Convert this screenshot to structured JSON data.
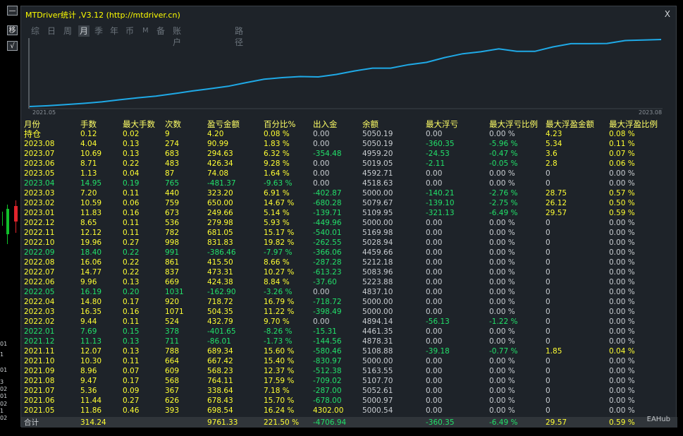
{
  "title": "MTDriver统计 ,V3.12 (http://mtdriver.cn)",
  "close_label": "X",
  "left_buttons": [
    "—",
    "移",
    "√"
  ],
  "side_axis_labels": [
    "01",
    "1",
    "01",
    "3",
    "02",
    "01",
    "02",
    "1",
    "02"
  ],
  "tabs": [
    "综",
    "日",
    "周",
    "月",
    "季",
    "年",
    "币",
    "M",
    "备",
    "账户",
    "路径"
  ],
  "active_tab": "月",
  "chart": {
    "x_start": "2021.05",
    "x_end": "2023.08",
    "line_color": "#1fa9e6",
    "values": [
      4902,
      4910,
      4922,
      4935,
      4950,
      4972,
      4993,
      5010,
      5035,
      5063,
      5086,
      5112,
      5150,
      5185,
      5202,
      5213,
      5209,
      5235,
      5271,
      5300,
      5300,
      5336,
      5360,
      5410,
      5449,
      5470,
      5500,
      5474,
      5474,
      5520,
      5554,
      5554,
      5556,
      5586,
      5592,
      5597
    ]
  },
  "columns": [
    "月份",
    "手数",
    "最大手数",
    "次数",
    "盈亏金额",
    "百分比%",
    "出入金",
    "余额",
    "最大浮亏",
    "最大浮亏比例",
    "最大浮盈金额",
    "最大浮盈比例"
  ],
  "rows": [
    {
      "c": [
        "持仓",
        "0.12",
        "0.02",
        "9",
        "4.20",
        "0.08 %",
        "0.00",
        "5050.19",
        "0.00",
        "0.00 %",
        "4.23",
        "0.08 %"
      ],
      "cls": "y",
      "f": {
        "8": "w",
        "9": "w",
        "6": "w",
        "7": "w"
      }
    },
    {
      "c": [
        "2023.08",
        "4.04",
        "0.13",
        "274",
        "90.99",
        "1.83 %",
        "0.00",
        "5050.19",
        "-360.35",
        "-5.96 %",
        "5.34",
        "0.11 %"
      ],
      "cls": "y",
      "f": {
        "6": "w",
        "7": "w",
        "8": "g",
        "9": "g"
      }
    },
    {
      "c": [
        "2023.07",
        "10.69",
        "0.13",
        "683",
        "294.63",
        "6.32 %",
        "-354.48",
        "4959.20",
        "-24.53",
        "-0.47 %",
        "3.6",
        "0.07 %"
      ],
      "cls": "y",
      "f": {
        "6": "g",
        "7": "w",
        "8": "g",
        "9": "g"
      }
    },
    {
      "c": [
        "2023.06",
        "8.71",
        "0.22",
        "483",
        "426.34",
        "9.28 %",
        "0.00",
        "5019.05",
        "-2.11",
        "-0.05 %",
        "2.8",
        "0.06 %"
      ],
      "cls": "y",
      "f": {
        "6": "w",
        "7": "w",
        "8": "g",
        "9": "g"
      }
    },
    {
      "c": [
        "2023.05",
        "1.13",
        "0.04",
        "87",
        "74.08",
        "1.64 %",
        "0.00",
        "4592.71",
        "0.00",
        "0.00 %",
        "0",
        "0.00 %"
      ],
      "cls": "y",
      "f": {
        "6": "w",
        "7": "w",
        "8": "w",
        "9": "w",
        "10": "w",
        "11": "w"
      }
    },
    {
      "c": [
        "2023.04",
        "14.95",
        "0.19",
        "765",
        "-481.37",
        "-9.63 %",
        "0.00",
        "4518.63",
        "0.00",
        "0.00 %",
        "0",
        "0.00 %"
      ],
      "cls": "g",
      "f": {
        "6": "w",
        "7": "w",
        "8": "w",
        "9": "w",
        "10": "w",
        "11": "w"
      }
    },
    {
      "c": [
        "2023.03",
        "7.20",
        "0.11",
        "440",
        "323.20",
        "6.91 %",
        "-402.87",
        "5000.00",
        "-140.21",
        "-2.76 %",
        "28.75",
        "0.57 %"
      ],
      "cls": "y",
      "f": {
        "6": "g",
        "7": "w",
        "8": "g",
        "9": "g"
      }
    },
    {
      "c": [
        "2023.02",
        "10.59",
        "0.06",
        "759",
        "650.00",
        "14.67 %",
        "-680.28",
        "5079.67",
        "-139.10",
        "-2.75 %",
        "26.12",
        "0.50 %"
      ],
      "cls": "y",
      "f": {
        "6": "g",
        "7": "w",
        "8": "g",
        "9": "g"
      }
    },
    {
      "c": [
        "2023.01",
        "11.83",
        "0.16",
        "673",
        "249.66",
        "5.14 %",
        "-139.71",
        "5109.95",
        "-321.13",
        "-6.49 %",
        "29.57",
        "0.59 %"
      ],
      "cls": "y",
      "f": {
        "6": "g",
        "7": "w",
        "8": "g",
        "9": "g"
      }
    },
    {
      "c": [
        "2022.12",
        "8.65",
        "0.11",
        "536",
        "279.98",
        "5.93 %",
        "-449.96",
        "5000.00",
        "0.00",
        "0.00 %",
        "0",
        "0.00 %"
      ],
      "cls": "y",
      "f": {
        "6": "g",
        "7": "w",
        "8": "w",
        "9": "w",
        "10": "w",
        "11": "w"
      }
    },
    {
      "c": [
        "2022.11",
        "12.12",
        "0.11",
        "782",
        "681.05",
        "15.17 %",
        "-540.01",
        "5169.98",
        "0.00",
        "0.00 %",
        "0",
        "0.00 %"
      ],
      "cls": "y",
      "f": {
        "6": "g",
        "7": "w",
        "8": "w",
        "9": "w",
        "10": "w",
        "11": "w"
      }
    },
    {
      "c": [
        "2022.10",
        "19.96",
        "0.27",
        "998",
        "831.83",
        "19.82 %",
        "-262.55",
        "5028.94",
        "0.00",
        "0.00 %",
        "0",
        "0.00 %"
      ],
      "cls": "y",
      "f": {
        "6": "g",
        "7": "w",
        "8": "w",
        "9": "w",
        "10": "w",
        "11": "w"
      }
    },
    {
      "c": [
        "2022.09",
        "18.40",
        "0.22",
        "991",
        "-386.46",
        "-7.97 %",
        "-366.06",
        "4459.66",
        "0.00",
        "0.00 %",
        "0",
        "0.00 %"
      ],
      "cls": "g",
      "f": {
        "7": "w",
        "8": "w",
        "9": "w",
        "10": "w",
        "11": "w"
      }
    },
    {
      "c": [
        "2022.08",
        "16.06",
        "0.22",
        "861",
        "415.50",
        "8.66 %",
        "-287.28",
        "5212.18",
        "0.00",
        "0.00 %",
        "0",
        "0.00 %"
      ],
      "cls": "y",
      "f": {
        "6": "g",
        "7": "w",
        "8": "w",
        "9": "w",
        "10": "w",
        "11": "w"
      }
    },
    {
      "c": [
        "2022.07",
        "14.77",
        "0.22",
        "837",
        "473.31",
        "10.27 %",
        "-613.23",
        "5083.96",
        "0.00",
        "0.00 %",
        "0",
        "0.00 %"
      ],
      "cls": "y",
      "f": {
        "6": "g",
        "7": "w",
        "8": "w",
        "9": "w",
        "10": "w",
        "11": "w"
      }
    },
    {
      "c": [
        "2022.06",
        "9.96",
        "0.13",
        "669",
        "424.38",
        "8.84 %",
        "-37.60",
        "5223.88",
        "0.00",
        "0.00 %",
        "0",
        "0.00 %"
      ],
      "cls": "y",
      "f": {
        "6": "g",
        "7": "w",
        "8": "w",
        "9": "w",
        "10": "w",
        "11": "w"
      }
    },
    {
      "c": [
        "2022.05",
        "16.19",
        "0.20",
        "1031",
        "-162.90",
        "-3.26 %",
        "0.00",
        "4837.10",
        "0.00",
        "0.00 %",
        "0",
        "0.00 %"
      ],
      "cls": "g",
      "f": {
        "6": "w",
        "7": "w",
        "8": "w",
        "9": "w",
        "10": "w",
        "11": "w"
      }
    },
    {
      "c": [
        "2022.04",
        "14.80",
        "0.17",
        "920",
        "718.72",
        "16.79 %",
        "-718.72",
        "5000.00",
        "0.00",
        "0.00 %",
        "0",
        "0.00 %"
      ],
      "cls": "y",
      "f": {
        "6": "g",
        "7": "w",
        "8": "w",
        "9": "w",
        "10": "w",
        "11": "w"
      }
    },
    {
      "c": [
        "2022.03",
        "16.35",
        "0.16",
        "1071",
        "504.35",
        "11.22 %",
        "-398.49",
        "5000.00",
        "0.00",
        "0.00 %",
        "0",
        "0.00 %"
      ],
      "cls": "y",
      "f": {
        "6": "g",
        "7": "w",
        "8": "w",
        "9": "w",
        "10": "w",
        "11": "w"
      }
    },
    {
      "c": [
        "2022.02",
        "9.44",
        "0.11",
        "524",
        "432.79",
        "9.70 %",
        "0.00",
        "4894.14",
        "-56.13",
        "-1.22 %",
        "0",
        "0.00 %"
      ],
      "cls": "y",
      "f": {
        "6": "w",
        "7": "w",
        "8": "g",
        "9": "g",
        "10": "w",
        "11": "w"
      }
    },
    {
      "c": [
        "2022.01",
        "7.69",
        "0.15",
        "378",
        "-401.65",
        "-8.26 %",
        "-15.31",
        "4461.35",
        "0.00",
        "0.00 %",
        "0",
        "0.00 %"
      ],
      "cls": "g",
      "f": {
        "7": "w",
        "8": "w",
        "9": "w",
        "10": "w",
        "11": "w"
      }
    },
    {
      "c": [
        "2021.12",
        "11.13",
        "0.13",
        "711",
        "-86.01",
        "-1.73 %",
        "-144.56",
        "4878.31",
        "0.00",
        "0.00 %",
        "0",
        "0.00 %"
      ],
      "cls": "g",
      "f": {
        "7": "w",
        "8": "w",
        "9": "w",
        "10": "w",
        "11": "w"
      }
    },
    {
      "c": [
        "2021.11",
        "12.07",
        "0.13",
        "788",
        "689.34",
        "15.60 %",
        "-580.46",
        "5108.88",
        "-39.18",
        "-0.77 %",
        "1.85",
        "0.04 %"
      ],
      "cls": "y",
      "f": {
        "6": "g",
        "7": "w",
        "8": "g",
        "9": "g"
      }
    },
    {
      "c": [
        "2021.10",
        "10.30",
        "0.11",
        "664",
        "667.42",
        "15.40 %",
        "-830.97",
        "5000.00",
        "0.00",
        "0.00 %",
        "0",
        "0.00 %"
      ],
      "cls": "y",
      "f": {
        "6": "g",
        "7": "w",
        "8": "w",
        "9": "w",
        "10": "w",
        "11": "w"
      }
    },
    {
      "c": [
        "2021.09",
        "8.96",
        "0.07",
        "609",
        "568.23",
        "12.37 %",
        "-512.38",
        "5163.55",
        "0.00",
        "0.00 %",
        "0",
        "0.00 %"
      ],
      "cls": "y",
      "f": {
        "6": "g",
        "7": "w",
        "8": "w",
        "9": "w",
        "10": "w",
        "11": "w"
      }
    },
    {
      "c": [
        "2021.08",
        "9.47",
        "0.17",
        "568",
        "764.11",
        "17.59 %",
        "-709.02",
        "5107.70",
        "0.00",
        "0.00 %",
        "0",
        "0.00 %"
      ],
      "cls": "y",
      "f": {
        "6": "g",
        "7": "w",
        "8": "w",
        "9": "w",
        "10": "w",
        "11": "w"
      }
    },
    {
      "c": [
        "2021.07",
        "5.36",
        "0.09",
        "367",
        "338.64",
        "7.18 %",
        "-287.00",
        "5052.61",
        "0.00",
        "0.00 %",
        "0",
        "0.00 %"
      ],
      "cls": "y",
      "f": {
        "6": "g",
        "7": "w",
        "8": "w",
        "9": "w",
        "10": "w",
        "11": "w"
      }
    },
    {
      "c": [
        "2021.06",
        "11.44",
        "0.27",
        "626",
        "678.43",
        "15.70 %",
        "-678.00",
        "5000.97",
        "0.00",
        "0.00 %",
        "0",
        "0.00 %"
      ],
      "cls": "y",
      "f": {
        "6": "g",
        "7": "w",
        "8": "w",
        "9": "w",
        "10": "w",
        "11": "w"
      }
    },
    {
      "c": [
        "2021.05",
        "11.86",
        "0.46",
        "393",
        "698.54",
        "16.24 %",
        "4302.00",
        "5000.54",
        "0.00",
        "0.00 %",
        "0",
        "0.00 %"
      ],
      "cls": "y",
      "f": {
        "7": "w",
        "8": "w",
        "9": "w",
        "10": "w",
        "11": "w"
      }
    }
  ],
  "total": {
    "c": [
      "合计",
      "314.24",
      "",
      "",
      "9761.33",
      "221.50 %",
      "-4706.94",
      "",
      "-360.35",
      "-6.49 %",
      "29.57",
      "0.59 %"
    ],
    "cls": "y",
    "f": {
      "0": "w",
      "6": "g",
      "8": "g",
      "9": "g"
    }
  },
  "watermark": "EAHub"
}
